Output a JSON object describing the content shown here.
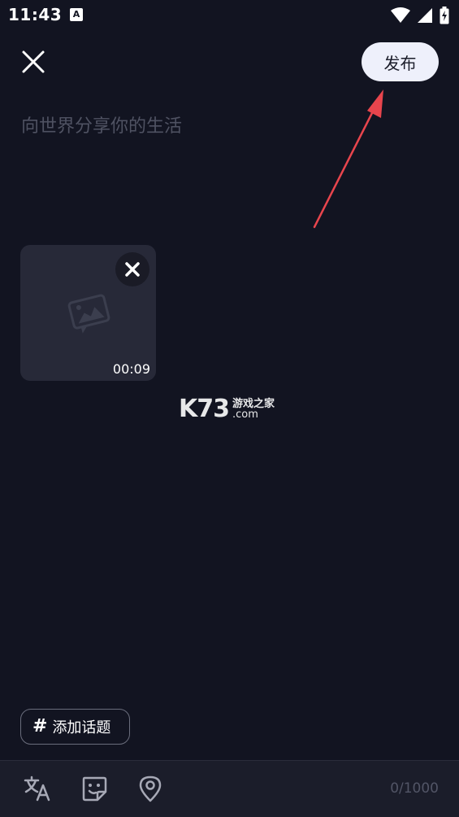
{
  "status_bar": {
    "time": "11:43",
    "app_icon_letter": "A"
  },
  "header": {
    "publish_label": "发布"
  },
  "composer": {
    "placeholder": "向世界分享你的生活",
    "value": ""
  },
  "media": {
    "duration": "00:09"
  },
  "watermark": {
    "brand": "K73",
    "name": "游戏之家",
    "domain": ".com"
  },
  "topic": {
    "hash": "#",
    "label": "添加话题"
  },
  "toolbar": {
    "char_count": "0/1000"
  },
  "colors": {
    "background": "#121421",
    "publish_button_bg": "#eef0fb",
    "annotation_arrow": "#e8454d",
    "placeholder_text": "#4f5262"
  }
}
